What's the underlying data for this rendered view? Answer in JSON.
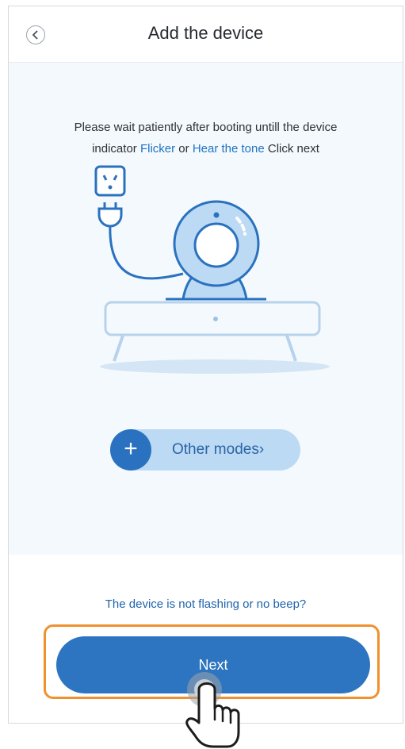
{
  "header": {
    "title": "Add the device"
  },
  "instruction": {
    "line1": "Please wait patiently after booting untill the device",
    "prefix": "indicator ",
    "link1": "Flicker",
    "middle": " or ",
    "link2": "Hear the tone",
    "suffix": " Click next"
  },
  "other_modes": {
    "icon": "plus-icon",
    "label": "Other modes",
    "chevron": "›"
  },
  "help_link": "The device is not flashing or no beep?",
  "next_button": "Next",
  "colors": {
    "accent": "#2d75c0",
    "highlight": "#f0912d",
    "background": "#f4f9fd"
  }
}
